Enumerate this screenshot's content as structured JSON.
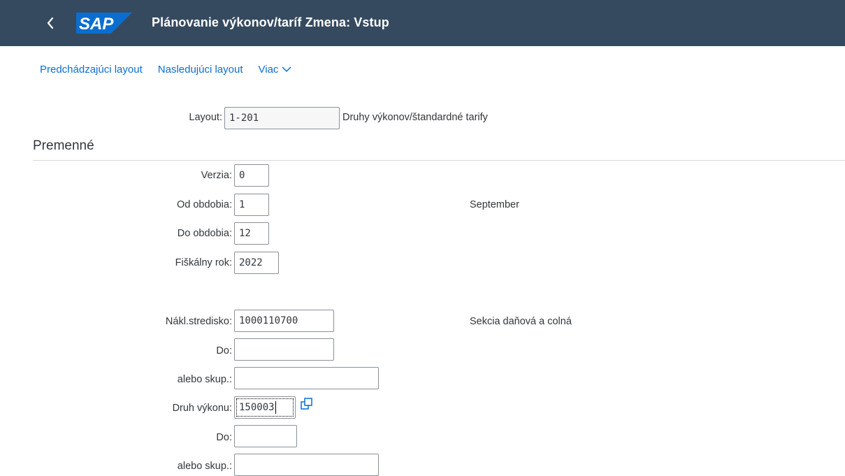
{
  "header": {
    "back_label": "<",
    "logo_text": "SAP",
    "title": "Plánovanie výkonov/taríf Zmena: Vstup",
    "bg_color": "#354a5f",
    "logo_color": "#0a6ed1"
  },
  "toolbar": {
    "prev_layout": "Predchádzajúci layout",
    "next_layout": "Nasledujúci layout",
    "more": "Viac"
  },
  "layout": {
    "label": "Layout:",
    "value": "1-201",
    "description": "Druhy výkonov/štandardné tarify"
  },
  "section": {
    "title": "Premenné"
  },
  "fields": {
    "version": {
      "label": "Verzia:",
      "value": "0"
    },
    "from_period": {
      "label": "Od obdobia:",
      "value": "1",
      "description": "September"
    },
    "to_period": {
      "label": "Do obdobia:",
      "value": "12"
    },
    "fiscal_year": {
      "label": "Fiškálny rok:",
      "value": "2022"
    },
    "cost_center": {
      "label": "Nákl.stredisko:",
      "value": "1000110700",
      "description": "Sekcia daňová a colná"
    },
    "cost_center_to": {
      "label": "Do:",
      "value": ""
    },
    "cost_center_group": {
      "label": "alebo skup.:",
      "value": ""
    },
    "activity_type": {
      "label": "Druh výkonu:",
      "value": "150003"
    },
    "activity_type_to": {
      "label": "Do:",
      "value": ""
    },
    "activity_type_group": {
      "label": "alebo skup.:",
      "value": ""
    }
  }
}
